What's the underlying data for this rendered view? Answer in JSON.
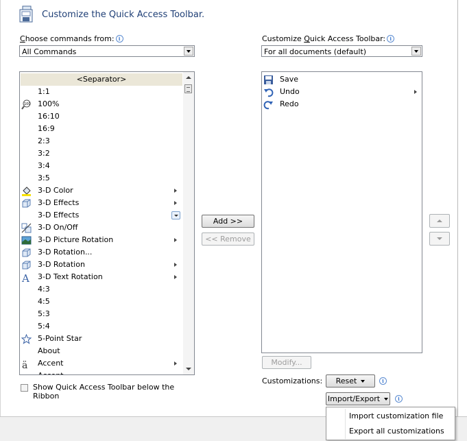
{
  "header": {
    "title": "Customize the Quick Access Toolbar."
  },
  "left": {
    "choose_label_pre": "",
    "choose_label_u": "C",
    "choose_label_post": "hoose commands from:",
    "combo_value": "All Commands",
    "commands": [
      {
        "label": "<Separator>",
        "icon": "none",
        "submenu": false,
        "selected": true
      },
      {
        "label": "1:1",
        "icon": "none",
        "submenu": false
      },
      {
        "label": "100%",
        "icon": "zoom-100-icon",
        "submenu": false
      },
      {
        "label": "16:10",
        "icon": "none",
        "submenu": false
      },
      {
        "label": "16:9",
        "icon": "none",
        "submenu": false
      },
      {
        "label": "2:3",
        "icon": "none",
        "submenu": false
      },
      {
        "label": "3:2",
        "icon": "none",
        "submenu": false
      },
      {
        "label": "3:4",
        "icon": "none",
        "submenu": false
      },
      {
        "label": "3:5",
        "icon": "none",
        "submenu": false
      },
      {
        "label": "3-D Color",
        "icon": "paint-bucket-icon",
        "submenu": true
      },
      {
        "label": "3-D Effects",
        "icon": "cube-icon",
        "submenu": true
      },
      {
        "label": "3-D Effects",
        "icon": "none",
        "submenu": false,
        "dropdown": true
      },
      {
        "label": "3-D On/Off",
        "icon": "3d-toggle-icon",
        "submenu": false
      },
      {
        "label": "3-D Picture Rotation",
        "icon": "picture-rotation-icon",
        "submenu": true
      },
      {
        "label": "3-D Rotation...",
        "icon": "cube-icon",
        "submenu": false
      },
      {
        "label": "3-D Rotation",
        "icon": "cube-icon",
        "submenu": true
      },
      {
        "label": "3-D Text Rotation",
        "icon": "text-a-icon",
        "submenu": true
      },
      {
        "label": "4:3",
        "icon": "none",
        "submenu": false
      },
      {
        "label": "4:5",
        "icon": "none",
        "submenu": false
      },
      {
        "label": "5:3",
        "icon": "none",
        "submenu": false
      },
      {
        "label": "5:4",
        "icon": "none",
        "submenu": false
      },
      {
        "label": "5-Point Star",
        "icon": "star-icon",
        "submenu": false
      },
      {
        "label": "About",
        "icon": "none",
        "submenu": false
      },
      {
        "label": "Accent",
        "icon": "accent-a-icon",
        "submenu": true
      },
      {
        "label": "Accept",
        "icon": "none",
        "submenu": false
      }
    ]
  },
  "right": {
    "toolbar_label_pre": "Customize ",
    "toolbar_label_u": "Q",
    "toolbar_label_post": "uick Access Toolbar:",
    "combo_value": "For all documents (default)",
    "items": [
      {
        "label": "Save",
        "icon": "save-icon"
      },
      {
        "label": "Undo",
        "icon": "undo-icon",
        "submenu": true
      },
      {
        "label": "Redo",
        "icon": "redo-icon"
      }
    ],
    "modify_label": "Modify...",
    "customizations_label": "Customizations:",
    "reset_label": "Reset",
    "import_export_label": "Import/Export"
  },
  "middle": {
    "add_label": "Add >>",
    "remove_label": "<< Remove"
  },
  "footer_check": {
    "label_line1": "Show Quick Access Toolbar below the",
    "label_line2": "Ribbon",
    "checked": false
  },
  "menu": {
    "items": [
      "Import customization file",
      "Export all customizations"
    ]
  }
}
